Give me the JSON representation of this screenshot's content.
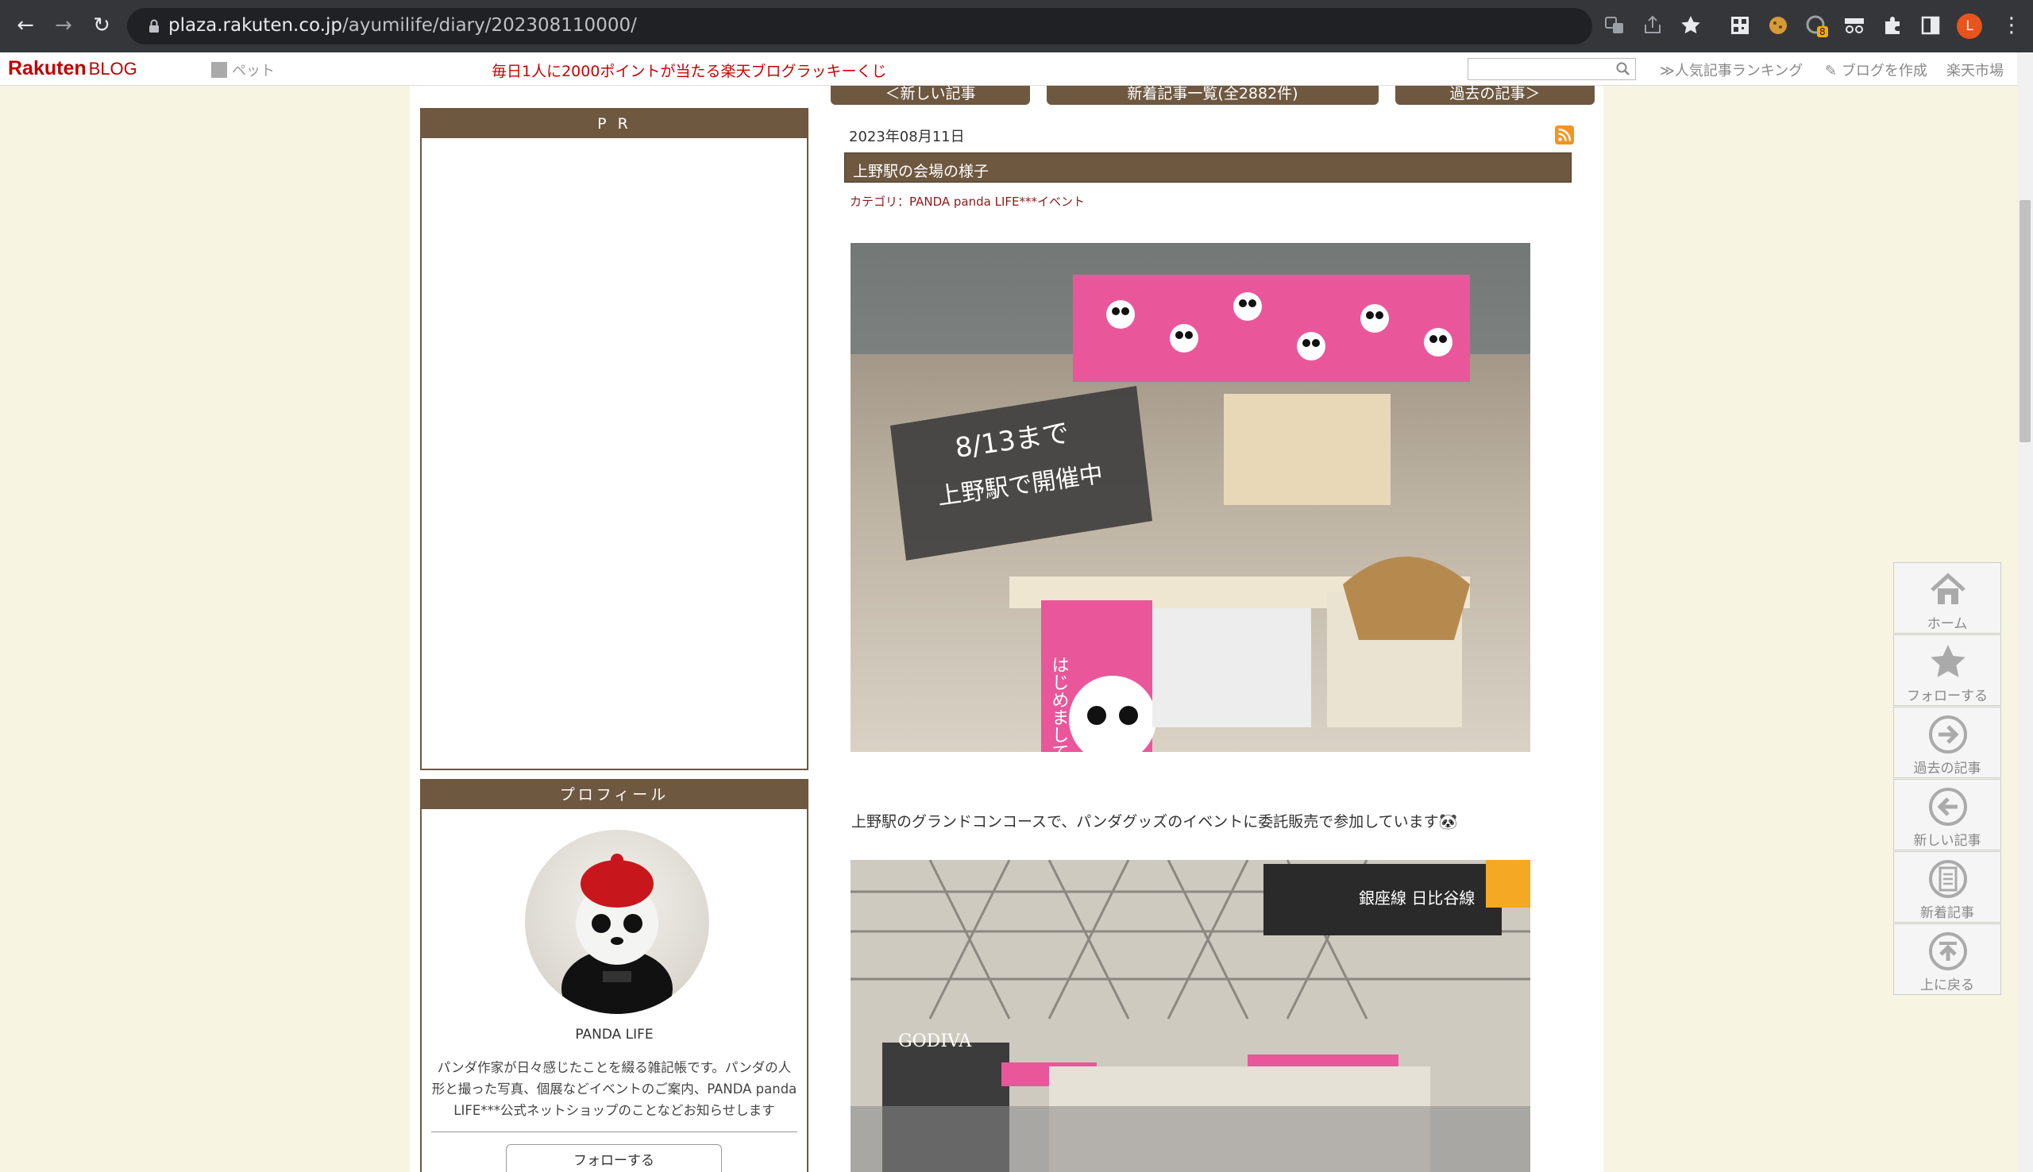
{
  "browser": {
    "url_host": "plaza.rakuten.co.jp",
    "url_path": "/ayumilife/diary/202308110000/",
    "back_icon": "arrow-left-icon",
    "forward_icon": "arrow-right-icon",
    "reload_icon": "reload-icon",
    "profile_initial": "L",
    "extension_badge": "8"
  },
  "rakuten_bar": {
    "logo": "Rakuten",
    "logo_suffix": "BLOG",
    "pet_label": "ペット",
    "lottery": "毎日1人に2000ポイントが当たる楽天ブログラッキーくじ",
    "ranking": "≫人気記事ランキング",
    "create": "ブログを作成",
    "market": "楽天市場"
  },
  "left": {
    "pr_header": "P R",
    "profile_header": "プロフィール",
    "profile_name": "PANDA LIFE",
    "profile_desc": "パンダ作家が日々感じたことを綴る雑記帳です。パンダの人形と撮った写真、個展などイベントのご案内、PANDA panda LIFE***公式ネットショップのことなどお知らせします",
    "follow": "フォローする"
  },
  "post": {
    "nav_newer": "＜新しい記事",
    "nav_list": "新着記事一覧(全2882件)",
    "nav_older": "過去の記事＞",
    "date": "2023年08月11日",
    "title": "上野駅の会場の様子",
    "category": "カテゴリ：PANDA panda LIFE***イベント",
    "photo1_sign_line1": "8/13まで",
    "photo1_sign_line2": "上野駅で開催中",
    "photo1_booth_text": "はじめまして",
    "caption": "上野駅のグランドコンコースで、パンダグッズのイベントに委託販売で参加しています🐼",
    "photo2_store": "GODIVA",
    "photo2_sign": "銀座線 日比谷線"
  },
  "sidebar": {
    "home": "ホーム",
    "follow": "フォローする",
    "older": "過去の記事",
    "newer": "新しい記事",
    "latest": "新着記事",
    "top": "上に戻る"
  }
}
